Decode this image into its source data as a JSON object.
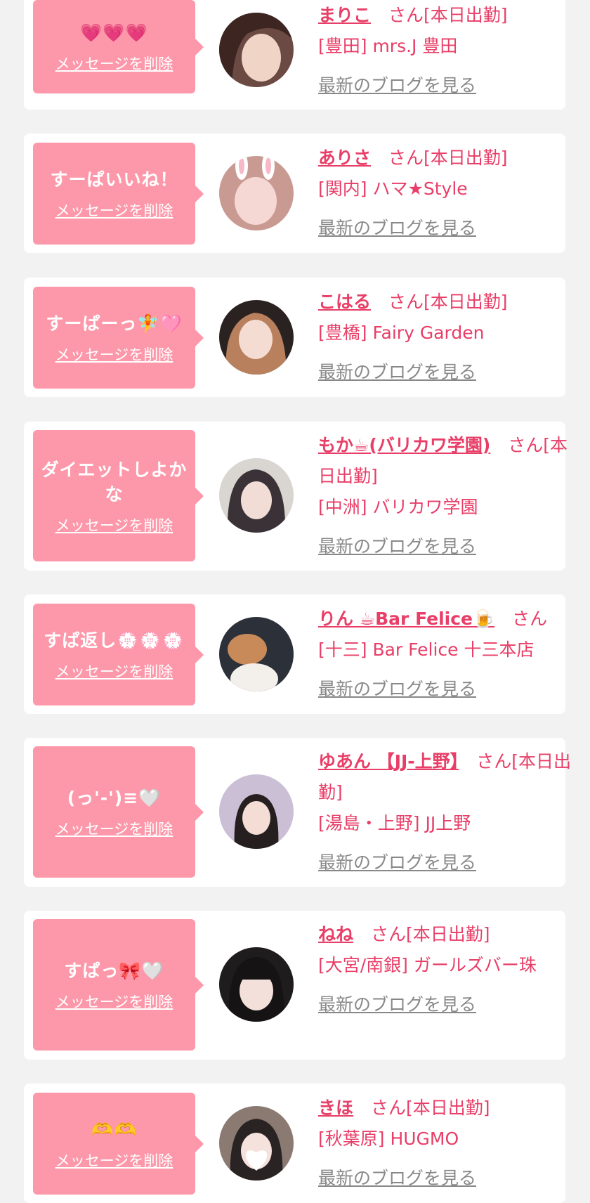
{
  "delete_label": "メッセージを削除",
  "blog_label": "最新のブログを見る",
  "colors": {
    "accent": "#e83e67",
    "bubble": "#fd98aa",
    "link_gray": "#888888"
  },
  "cards": [
    {
      "message": "💗💗💗",
      "name": "まりこ",
      "suffix": "さん[本日出勤]",
      "shop": "[豊田] mrs.J 豊田"
    },
    {
      "message": "すーぱいいね！",
      "name": "ありさ",
      "suffix": "さん[本日出勤]",
      "shop": "[関内] ハマ★Style"
    },
    {
      "message": "すーぱーっ🧚🩷",
      "name": "こはる",
      "suffix": "さん[本日出勤]",
      "shop": "[豊橋] Fairy Garden"
    },
    {
      "message": "ダイエットしよかな",
      "name": "もか☕(バリカワ学園)",
      "suffix": "さん[本日出勤]",
      "shop": "[中洲] バリカワ学園"
    },
    {
      "message": "すぱ返し💮💮💮",
      "name": "りん ☕Bar Felice🍺",
      "suffix": "さん",
      "shop": "[十三] Bar Felice 十三本店"
    },
    {
      "message": "(っ'-')≡🤍",
      "name": "ゆあん 【JJ-上野】",
      "suffix": "さん[本日出勤]",
      "shop": "[湯島・上野] JJ上野"
    },
    {
      "message": "すぱっ🎀🤍",
      "name": "ねね",
      "suffix": "さん[本日出勤]",
      "shop": "[大宮/南銀] ガールズバー珠"
    },
    {
      "message": "🫶🫶",
      "name": "きほ",
      "suffix": "さん[本日出勤]",
      "shop": "[秋葉原] HUGMO"
    }
  ]
}
